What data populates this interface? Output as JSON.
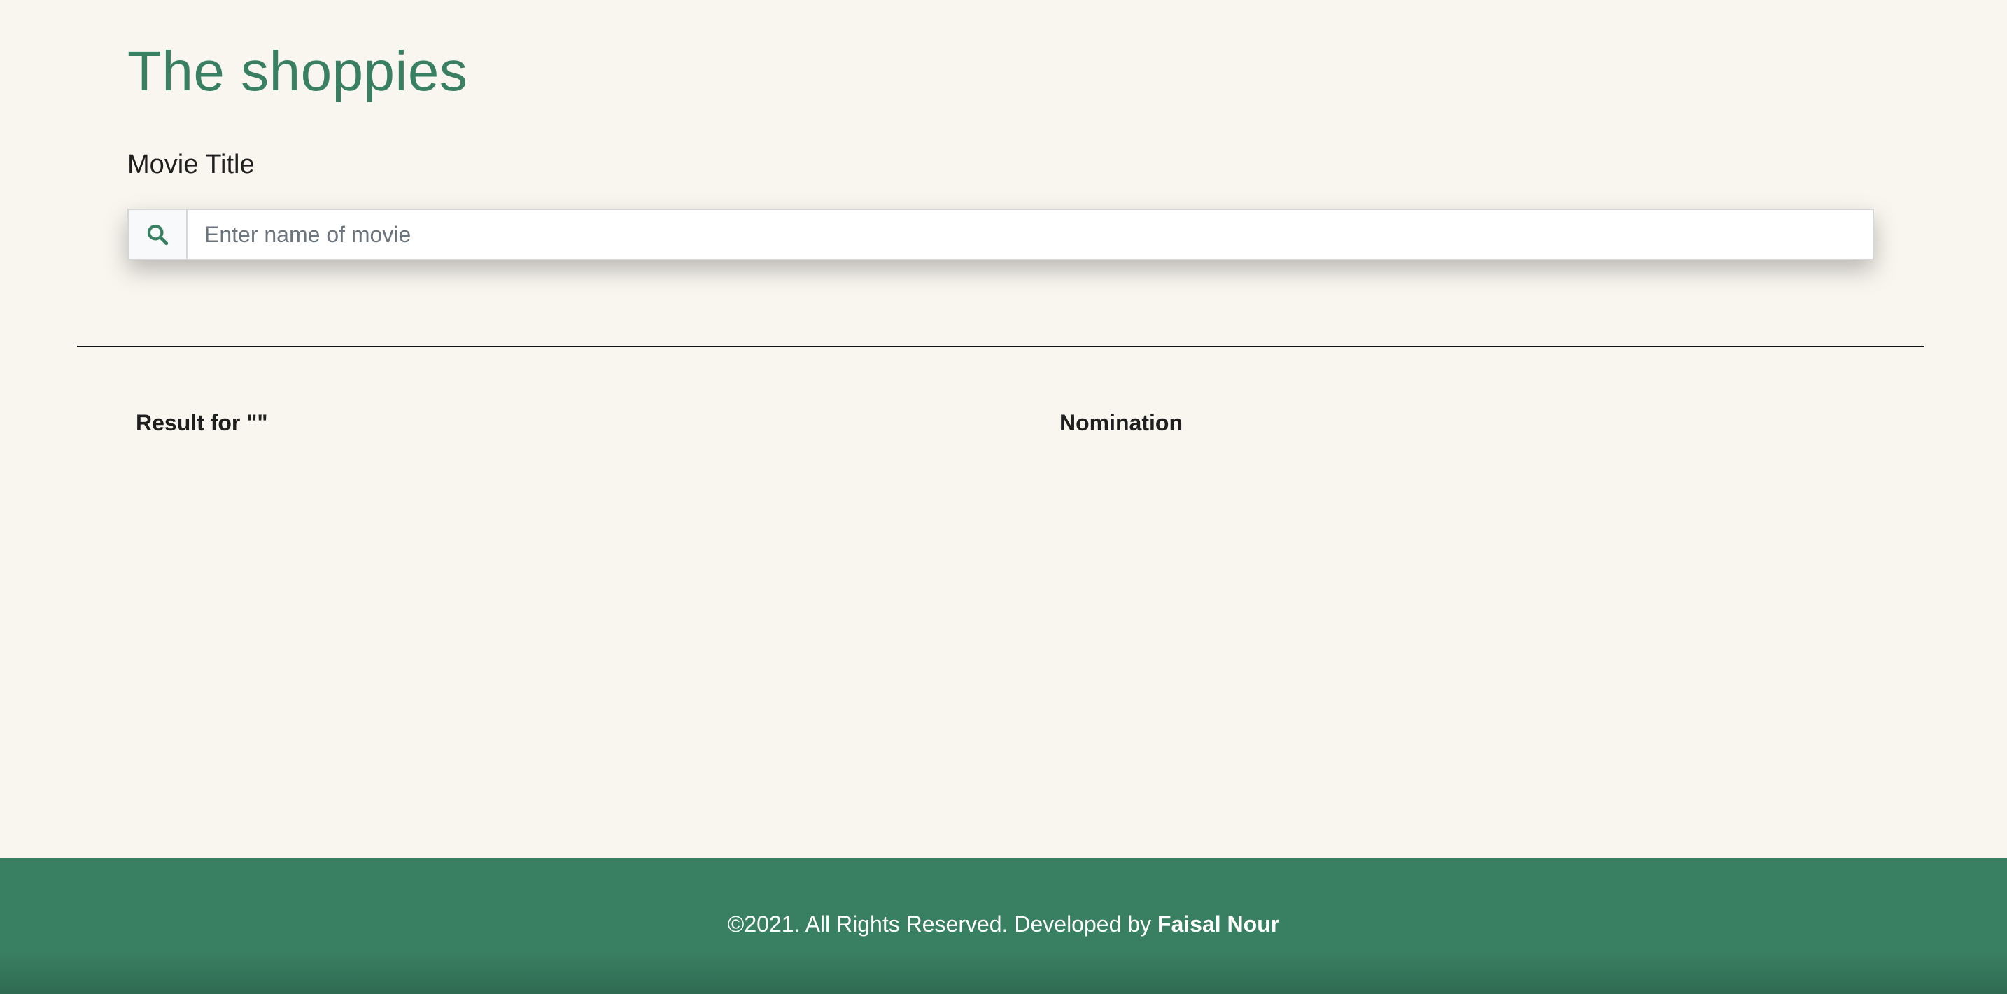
{
  "header": {
    "title": "The shoppies"
  },
  "search": {
    "label": "Movie Title",
    "placeholder": "Enter name of movie",
    "value": ""
  },
  "results": {
    "heading": "Result for \"\""
  },
  "nominations": {
    "heading": "Nomination"
  },
  "footer": {
    "text": "©2021. All Rights Reserved. Developed by ",
    "author": "Faisal Nour"
  },
  "colors": {
    "brand": "#397f62",
    "background": "#f9f6ef"
  },
  "icons": {
    "search": "search-icon"
  }
}
